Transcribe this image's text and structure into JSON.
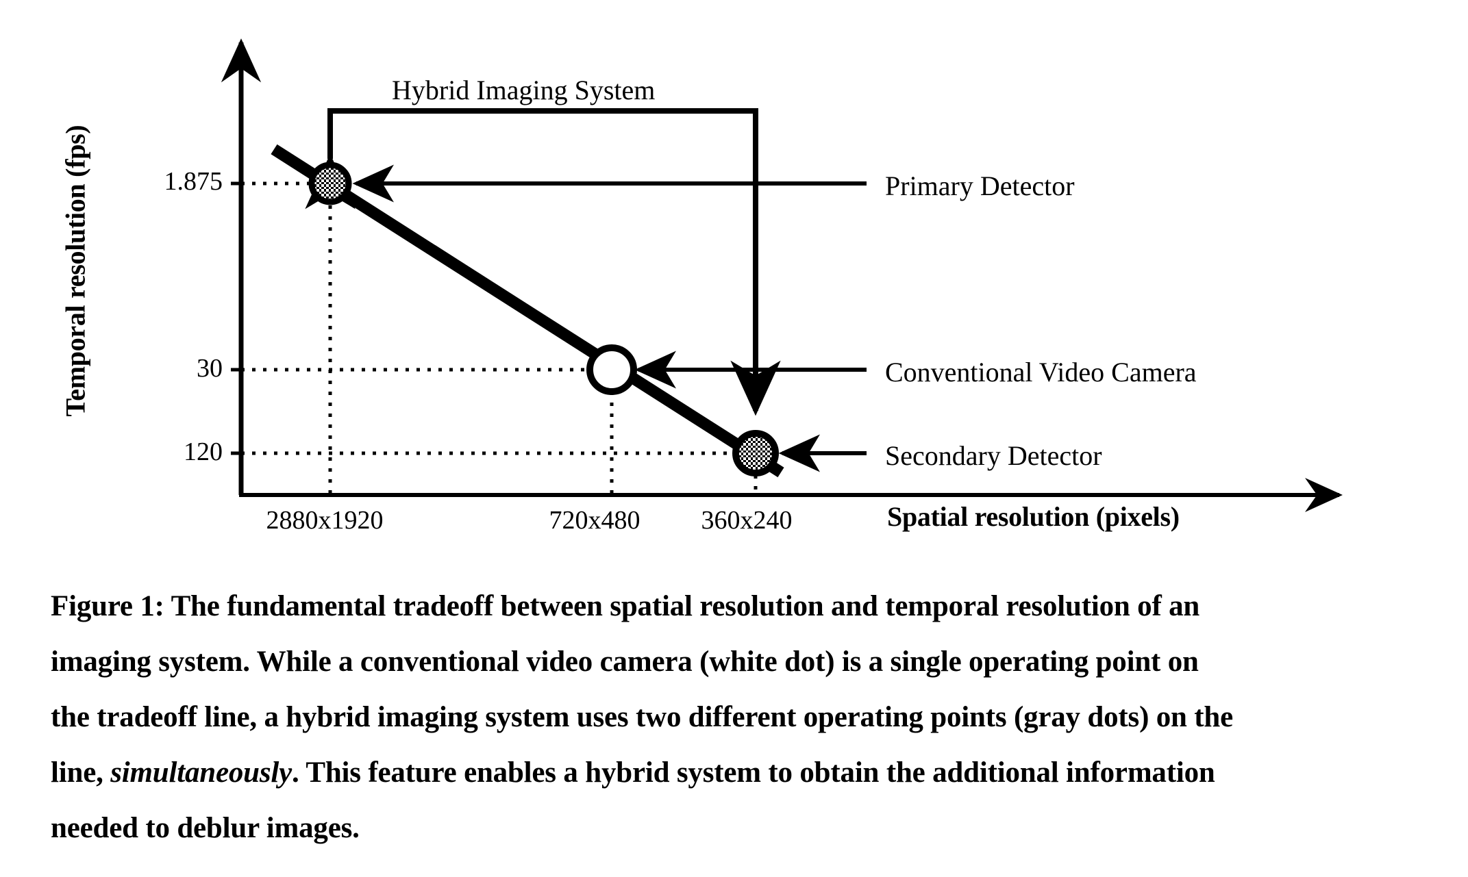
{
  "figure": {
    "bracket_title": "Hybrid Imaging System",
    "y_axis_title": "Temporal resolution (fps)",
    "x_axis_title": "Spatial resolution (pixels)",
    "callouts": [
      {
        "label": "Primary Detector"
      },
      {
        "label": "Conventional Video Camera"
      },
      {
        "label": "Secondary Detector"
      }
    ]
  },
  "chart_data": {
    "type": "line",
    "title": "",
    "xlabel": "Spatial resolution (pixels)",
    "ylabel": "Temporal resolution (fps)",
    "grid": "dotted-guides",
    "legend": "none",
    "x_tick_labels": [
      "2880x1920",
      "720x480",
      "360x240"
    ],
    "y_tick_labels": [
      "1.875",
      "30",
      "120"
    ],
    "x_axis_note": "spatial resolution decreases left to right",
    "y_axis_note": "temporal resolution in fps increases downward",
    "series": [
      {
        "name": "Tradeoff line",
        "style": "thick-solid",
        "x": [
          "2880x1920",
          "720x480",
          "360x240"
        ],
        "y": [
          1.875,
          30,
          120
        ]
      }
    ],
    "points": [
      {
        "name": "Primary Detector",
        "x": "2880x1920",
        "y": 1.875,
        "marker": "gray-speckled-circle",
        "color": "#808080"
      },
      {
        "name": "Conventional Video Camera",
        "x": "720x480",
        "y": 30,
        "marker": "white-circle",
        "color": "#ffffff"
      },
      {
        "name": "Secondary Detector",
        "x": "360x240",
        "y": 120,
        "marker": "gray-speckled-circle",
        "color": "#808080"
      }
    ],
    "annotations": [
      {
        "text": "Hybrid Imaging System",
        "type": "bracket",
        "spans": [
          "2880x1920",
          "360x240"
        ]
      }
    ]
  },
  "caption": {
    "lines": [
      [
        {
          "text": "Figure 1: The fundamental tradeoff between spatial resolution and temporal resolution of an",
          "style": "normal"
        }
      ],
      [
        {
          "text": "imaging system.  While a conventional video camera (white dot) is a single operating point on",
          "style": "normal"
        }
      ],
      [
        {
          "text": "the tradeoff line, a hybrid imaging system uses two different operating points (gray dots) on the",
          "style": "normal"
        }
      ],
      [
        {
          "text": "line, ",
          "style": "normal"
        },
        {
          "text": "simultaneously",
          "style": "italic"
        },
        {
          "text": ". This feature enables a hybrid system to obtain the additional information",
          "style": "normal"
        }
      ],
      [
        {
          "text": "needed to deblur images.",
          "style": "normal"
        }
      ]
    ]
  }
}
